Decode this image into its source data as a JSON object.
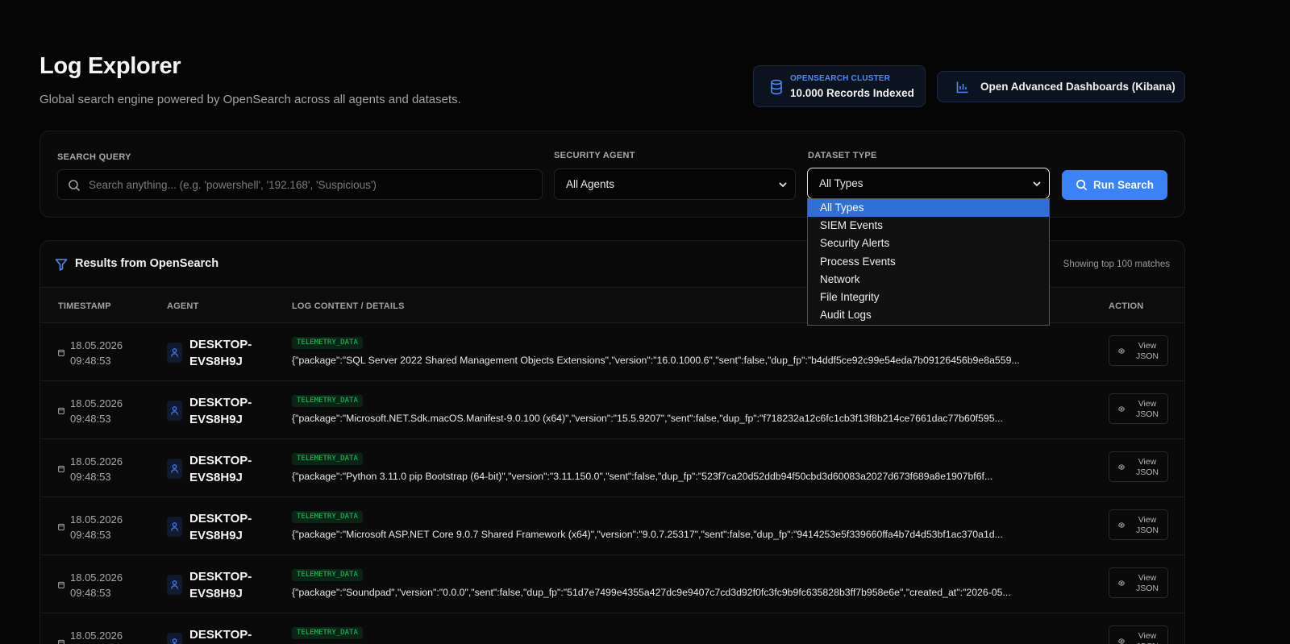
{
  "header": {
    "title": "Log Explorer",
    "subtitle": "Global search engine powered by OpenSearch across all agents and datasets."
  },
  "cluster": {
    "label": "OPENSEARCH CLUSTER",
    "value": "10.000 Records Indexed"
  },
  "kibana_button": {
    "label": "Open Advanced Dashboards (Kibana)"
  },
  "filters": {
    "search_label": "SEARCH QUERY",
    "search_value": "",
    "search_placeholder": "Search anything... (e.g. 'powershell', '192.168', 'Suspicious')",
    "agent_label": "SECURITY AGENT",
    "agent_value": "All Agents",
    "dataset_label": "DATASET TYPE",
    "dataset_value": "All Types",
    "dataset_options": [
      "All Types",
      "SIEM Events",
      "Security Alerts",
      "Process Events",
      "Network",
      "File Integrity",
      "Audit Logs"
    ],
    "run_label": "Run Search"
  },
  "results": {
    "title": "Results from OpenSearch",
    "count_text": "Showing top 100 matches",
    "columns": {
      "timestamp": "TIMESTAMP",
      "agent": "AGENT",
      "content": "LOG CONTENT / DETAILS",
      "action": "ACTION"
    },
    "view_button_label": "View JSON",
    "rows": [
      {
        "date": "18.05.2026",
        "time": "09:48:53",
        "agent": "DESKTOP-EVS8H9J",
        "tag": "TELEMETRY_DATA",
        "content": "{\"package\":\"SQL Server 2022 Shared Management Objects Extensions\",\"version\":\"16.0.1000.6\",\"sent\":false,\"dup_fp\":\"b4ddf5ce92c99e54eda7b09126456b9e8a559..."
      },
      {
        "date": "18.05.2026",
        "time": "09:48:53",
        "agent": "DESKTOP-EVS8H9J",
        "tag": "TELEMETRY_DATA",
        "content": "{\"package\":\"Microsoft.NET.Sdk.macOS.Manifest-9.0.100 (x64)\",\"version\":\"15.5.9207\",\"sent\":false,\"dup_fp\":\"f718232a12c6fc1cb3f13f8b214ce7661dac77b60f595..."
      },
      {
        "date": "18.05.2026",
        "time": "09:48:53",
        "agent": "DESKTOP-EVS8H9J",
        "tag": "TELEMETRY_DATA",
        "content": "{\"package\":\"Python 3.11.0 pip Bootstrap (64-bit)\",\"version\":\"3.11.150.0\",\"sent\":false,\"dup_fp\":\"523f7ca20d52ddb94f50cbd3d60083a2027d673f689a8e1907bf6f..."
      },
      {
        "date": "18.05.2026",
        "time": "09:48:53",
        "agent": "DESKTOP-EVS8H9J",
        "tag": "TELEMETRY_DATA",
        "content": "{\"package\":\"Microsoft ASP.NET Core 9.0.7 Shared Framework (x64)\",\"version\":\"9.0.7.25317\",\"sent\":false,\"dup_fp\":\"9414253e5f339660ffa4b7d4d53bf1ac370a1d..."
      },
      {
        "date": "18.05.2026",
        "time": "09:48:53",
        "agent": "DESKTOP-EVS8H9J",
        "tag": "TELEMETRY_DATA",
        "content": "{\"package\":\"Soundpad\",\"version\":\"0.0.0\",\"sent\":false,\"dup_fp\":\"51d7e7499e4355a427dc9e9407c7cd3d92f0fc3fc9b9fc635828b3ff7b958e6e\",\"created_at\":\"2026-05..."
      },
      {
        "date": "18.05.2026",
        "time": "",
        "agent": "DESKTOP-",
        "tag": "TELEMETRY_DATA",
        "content": ""
      }
    ]
  },
  "colors": {
    "accent": "#3b82f6",
    "tag_green": "#22c55e",
    "background": "#050505"
  },
  "icons": {
    "cluster": "database-icon",
    "kibana": "bar-chart-icon",
    "search": "search-icon",
    "results": "filter-icon",
    "timestamp": "calendar-icon",
    "agent": "user-icon",
    "view": "eye-icon"
  }
}
